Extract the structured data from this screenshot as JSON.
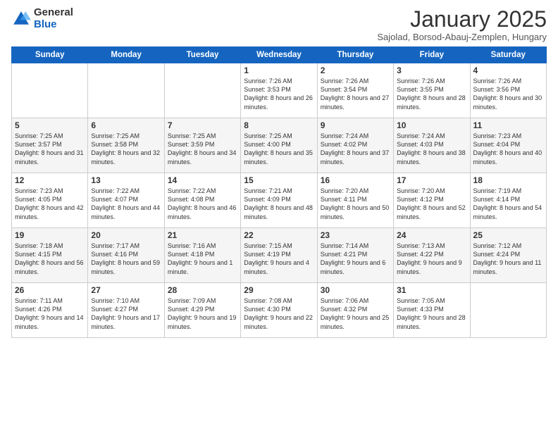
{
  "logo": {
    "general": "General",
    "blue": "Blue"
  },
  "header": {
    "title": "January 2025",
    "subtitle": "Sajolad, Borsod-Abauj-Zemplen, Hungary"
  },
  "weekdays": [
    "Sunday",
    "Monday",
    "Tuesday",
    "Wednesday",
    "Thursday",
    "Friday",
    "Saturday"
  ],
  "weeks": [
    [
      {
        "day": "",
        "info": ""
      },
      {
        "day": "",
        "info": ""
      },
      {
        "day": "",
        "info": ""
      },
      {
        "day": "1",
        "info": "Sunrise: 7:26 AM\nSunset: 3:53 PM\nDaylight: 8 hours and 26 minutes."
      },
      {
        "day": "2",
        "info": "Sunrise: 7:26 AM\nSunset: 3:54 PM\nDaylight: 8 hours and 27 minutes."
      },
      {
        "day": "3",
        "info": "Sunrise: 7:26 AM\nSunset: 3:55 PM\nDaylight: 8 hours and 28 minutes."
      },
      {
        "day": "4",
        "info": "Sunrise: 7:26 AM\nSunset: 3:56 PM\nDaylight: 8 hours and 30 minutes."
      }
    ],
    [
      {
        "day": "5",
        "info": "Sunrise: 7:25 AM\nSunset: 3:57 PM\nDaylight: 8 hours and 31 minutes."
      },
      {
        "day": "6",
        "info": "Sunrise: 7:25 AM\nSunset: 3:58 PM\nDaylight: 8 hours and 32 minutes."
      },
      {
        "day": "7",
        "info": "Sunrise: 7:25 AM\nSunset: 3:59 PM\nDaylight: 8 hours and 34 minutes."
      },
      {
        "day": "8",
        "info": "Sunrise: 7:25 AM\nSunset: 4:00 PM\nDaylight: 8 hours and 35 minutes."
      },
      {
        "day": "9",
        "info": "Sunrise: 7:24 AM\nSunset: 4:02 PM\nDaylight: 8 hours and 37 minutes."
      },
      {
        "day": "10",
        "info": "Sunrise: 7:24 AM\nSunset: 4:03 PM\nDaylight: 8 hours and 38 minutes."
      },
      {
        "day": "11",
        "info": "Sunrise: 7:23 AM\nSunset: 4:04 PM\nDaylight: 8 hours and 40 minutes."
      }
    ],
    [
      {
        "day": "12",
        "info": "Sunrise: 7:23 AM\nSunset: 4:05 PM\nDaylight: 8 hours and 42 minutes."
      },
      {
        "day": "13",
        "info": "Sunrise: 7:22 AM\nSunset: 4:07 PM\nDaylight: 8 hours and 44 minutes."
      },
      {
        "day": "14",
        "info": "Sunrise: 7:22 AM\nSunset: 4:08 PM\nDaylight: 8 hours and 46 minutes."
      },
      {
        "day": "15",
        "info": "Sunrise: 7:21 AM\nSunset: 4:09 PM\nDaylight: 8 hours and 48 minutes."
      },
      {
        "day": "16",
        "info": "Sunrise: 7:20 AM\nSunset: 4:11 PM\nDaylight: 8 hours and 50 minutes."
      },
      {
        "day": "17",
        "info": "Sunrise: 7:20 AM\nSunset: 4:12 PM\nDaylight: 8 hours and 52 minutes."
      },
      {
        "day": "18",
        "info": "Sunrise: 7:19 AM\nSunset: 4:14 PM\nDaylight: 8 hours and 54 minutes."
      }
    ],
    [
      {
        "day": "19",
        "info": "Sunrise: 7:18 AM\nSunset: 4:15 PM\nDaylight: 8 hours and 56 minutes."
      },
      {
        "day": "20",
        "info": "Sunrise: 7:17 AM\nSunset: 4:16 PM\nDaylight: 8 hours and 59 minutes."
      },
      {
        "day": "21",
        "info": "Sunrise: 7:16 AM\nSunset: 4:18 PM\nDaylight: 9 hours and 1 minute."
      },
      {
        "day": "22",
        "info": "Sunrise: 7:15 AM\nSunset: 4:19 PM\nDaylight: 9 hours and 4 minutes."
      },
      {
        "day": "23",
        "info": "Sunrise: 7:14 AM\nSunset: 4:21 PM\nDaylight: 9 hours and 6 minutes."
      },
      {
        "day": "24",
        "info": "Sunrise: 7:13 AM\nSunset: 4:22 PM\nDaylight: 9 hours and 9 minutes."
      },
      {
        "day": "25",
        "info": "Sunrise: 7:12 AM\nSunset: 4:24 PM\nDaylight: 9 hours and 11 minutes."
      }
    ],
    [
      {
        "day": "26",
        "info": "Sunrise: 7:11 AM\nSunset: 4:26 PM\nDaylight: 9 hours and 14 minutes."
      },
      {
        "day": "27",
        "info": "Sunrise: 7:10 AM\nSunset: 4:27 PM\nDaylight: 9 hours and 17 minutes."
      },
      {
        "day": "28",
        "info": "Sunrise: 7:09 AM\nSunset: 4:29 PM\nDaylight: 9 hours and 19 minutes."
      },
      {
        "day": "29",
        "info": "Sunrise: 7:08 AM\nSunset: 4:30 PM\nDaylight: 9 hours and 22 minutes."
      },
      {
        "day": "30",
        "info": "Sunrise: 7:06 AM\nSunset: 4:32 PM\nDaylight: 9 hours and 25 minutes."
      },
      {
        "day": "31",
        "info": "Sunrise: 7:05 AM\nSunset: 4:33 PM\nDaylight: 9 hours and 28 minutes."
      },
      {
        "day": "",
        "info": ""
      }
    ]
  ]
}
